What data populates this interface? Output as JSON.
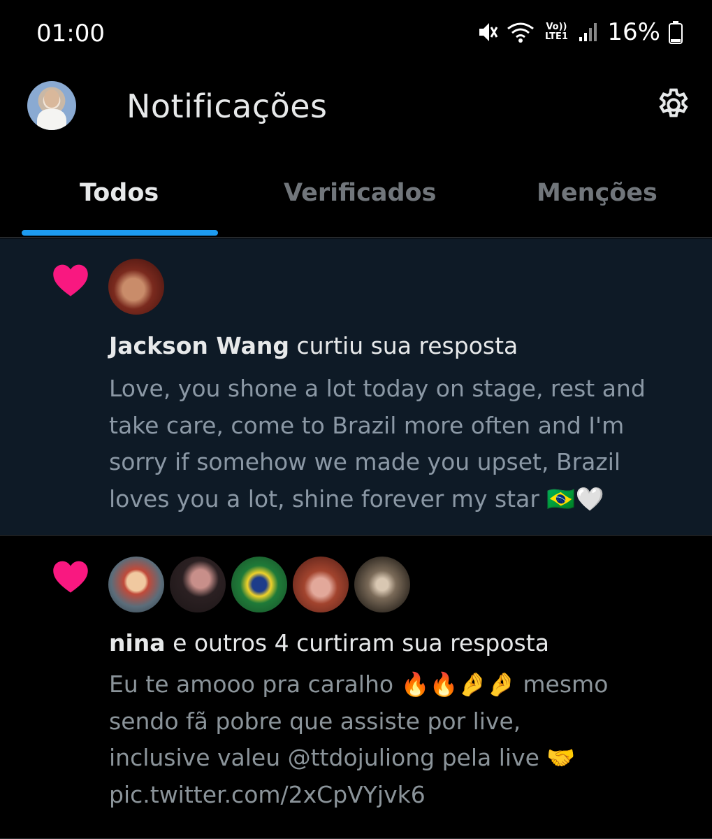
{
  "status_bar": {
    "time": "01:00",
    "network_label": "Vo)) LTE1",
    "battery": "16%",
    "icons": [
      "mute-icon",
      "wifi-icon",
      "signal-icon",
      "battery-icon"
    ]
  },
  "header": {
    "title": "Notificações",
    "settings_icon": "gear-icon"
  },
  "tabs": [
    {
      "label": "Todos",
      "active": true
    },
    {
      "label": "Verificados",
      "active": false
    },
    {
      "label": "Menções",
      "active": false
    }
  ],
  "colors": {
    "accent": "#1d9bf0",
    "heart": "#f91880",
    "highlight_bg": "#0e1a26"
  },
  "notifications": [
    {
      "icon": "heart-icon",
      "actor": "Jackson Wang",
      "action": " curtiu sua resposta",
      "body": "Love, you shone a lot today on stage, rest and\ntake care, come to Brazil more often and I'm\nsorry if somehow we made you upset, Brazil\nloves you a lot, shine forever my star 🇧🇷🤍"
    },
    {
      "icon": "heart-icon",
      "actor": "nina",
      "action": " e outros 4 curtiram sua resposta",
      "body": "Eu te amooo pra caralho 🔥🔥🤌🤌 mesmo\nsendo fã pobre que assiste por live,\ninclusive valeu @ttdojuliong pela live 🤝\npic.twitter.com/2xCpVYjvk6"
    }
  ]
}
